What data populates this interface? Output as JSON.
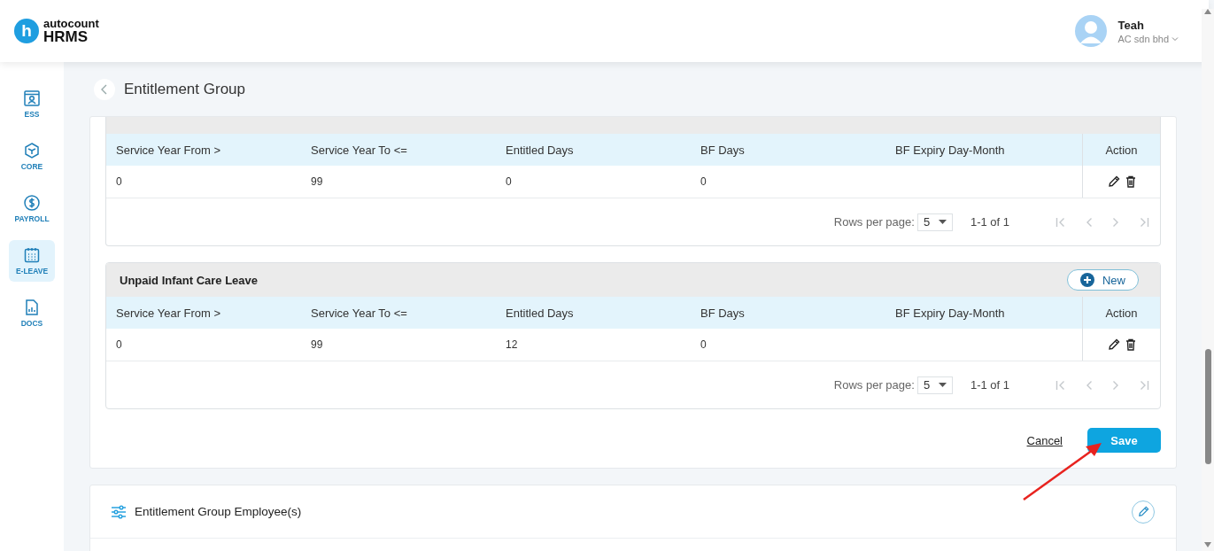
{
  "header": {
    "logo": {
      "brand_small": "autocount",
      "brand_large": "HRMS",
      "mark": "h"
    },
    "user": {
      "name": "Teah",
      "company": "AC sdn bhd"
    }
  },
  "sidebar": {
    "items": [
      {
        "label": "ESS",
        "kind": "profile",
        "selected": false
      },
      {
        "label": "CORE",
        "kind": "cube",
        "selected": false
      },
      {
        "label": "PAYROLL",
        "kind": "dollar",
        "selected": false
      },
      {
        "label": "E-LEAVE",
        "kind": "calendar",
        "selected": true
      },
      {
        "label": "DOCS",
        "kind": "document",
        "selected": false
      }
    ]
  },
  "page": {
    "title": "Entitlement Group"
  },
  "leave_sections": [
    {
      "columns": [
        "Service Year From >",
        "Service Year To <=",
        "Entitled Days",
        "BF Days",
        "BF Expiry Day-Month",
        "Action"
      ],
      "rows": [
        {
          "cells": [
            "0",
            "99",
            "0",
            "0",
            ""
          ]
        }
      ],
      "pagination": {
        "rows_per_page_label": "Rows per page:",
        "rows_per_page": "5",
        "range": "1-1 of 1"
      }
    },
    {
      "title": "Unpaid Infant Care Leave",
      "new_button": "New",
      "columns": [
        "Service Year From >",
        "Service Year To <=",
        "Entitled Days",
        "BF Days",
        "BF Expiry Day-Month",
        "Action"
      ],
      "rows": [
        {
          "cells": [
            "0",
            "99",
            "12",
            "0",
            ""
          ]
        }
      ],
      "pagination": {
        "rows_per_page_label": "Rows per page:",
        "rows_per_page": "5",
        "range": "1-1 of 1"
      }
    }
  ],
  "form_actions": {
    "cancel": "Cancel",
    "save": "Save"
  },
  "employees_panel": {
    "title": "Entitlement Group Employee(s)"
  }
}
